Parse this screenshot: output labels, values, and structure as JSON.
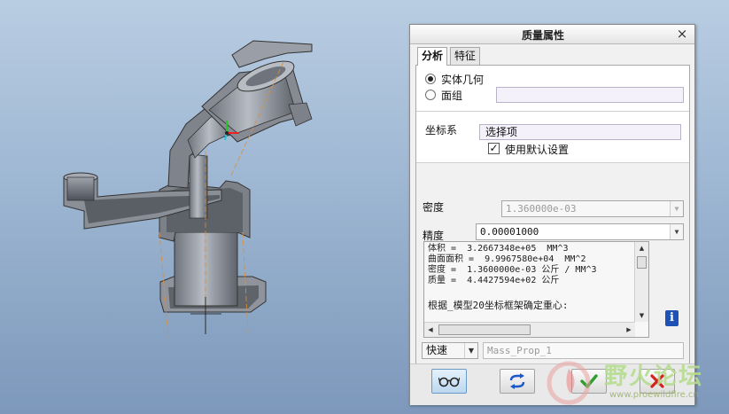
{
  "dialog": {
    "title": "质量属性",
    "close_glyph": "×",
    "tabs": [
      {
        "label": "分析",
        "active": true
      },
      {
        "label": "特征",
        "active": false
      }
    ],
    "geometry": {
      "options": [
        {
          "label": "实体几何",
          "selected": true
        },
        {
          "label": "面组",
          "selected": false
        }
      ],
      "quilt_value": ""
    },
    "coordinate_system": {
      "label": "坐标系",
      "selector_text": "选择项",
      "use_default_label": "使用默认设置",
      "use_default_checked": true
    },
    "density": {
      "label": "密度",
      "value": "1.360000e-03",
      "enabled": false
    },
    "accuracy": {
      "label": "精度",
      "value": "0.00001000"
    },
    "results": {
      "lines": [
        "体积 =  3.2667348e+05  MM^3",
        "曲面面积 =  9.9967580e+04  MM^2",
        "密度 =  1.3600000e-03 公斤 / MM^3",
        "质量 =  4.4427594e+02 公斤"
      ],
      "note": "根据_模型20坐标框架确定重心:"
    },
    "speed": {
      "value": "快速"
    },
    "feature_name": "Mass_Prop_1",
    "buttons": [
      {
        "name": "preview",
        "icon": "glasses-icon"
      },
      {
        "name": "repeat",
        "icon": "repeat-arrows-icon"
      },
      {
        "name": "ok",
        "icon": "checkmark-icon"
      },
      {
        "name": "cancel",
        "icon": "red-x-icon"
      }
    ],
    "info_glyph": "i"
  },
  "watermark": {
    "title": "野火论坛",
    "url": "www.proewildfire.cn"
  },
  "colors": {
    "accent_blue": "#1f52b5",
    "ok_green": "#2f9e2f",
    "cancel_red": "#d52020",
    "model_gray": "#8a8f98"
  }
}
